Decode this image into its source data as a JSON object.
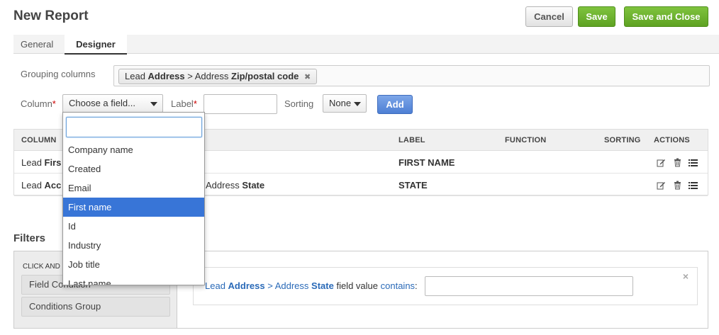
{
  "header": {
    "title": "New Report",
    "cancel_label": "Cancel",
    "save_label": "Save",
    "save_close_label": "Save and Close"
  },
  "tabs": [
    {
      "label": "General",
      "active": false
    },
    {
      "label": "Designer",
      "active": true
    }
  ],
  "designer": {
    "grouping_label": "Grouping columns",
    "grouping_tag": {
      "entity": "Lead",
      "relation": "Address",
      "separator": ">",
      "sub_entity": "Address",
      "field": "Zip/postal code"
    },
    "column_label": "Column",
    "column_placeholder": "Choose a field...",
    "label_label": "Label",
    "label_value": "",
    "sorting_label": "Sorting",
    "sorting_value": "None",
    "add_label": "Add",
    "required_mark": "*"
  },
  "grid": {
    "headers": [
      "COLUMN",
      "LABEL",
      "FUNCTION",
      "SORTING",
      "ACTIONS"
    ],
    "rows": [
      {
        "column_prefix": "Lead",
        "column_bold": "Firs",
        "column_tail": "",
        "column_tail_bold": "",
        "label": "FIRST NAME"
      },
      {
        "column_prefix": "Lead",
        "column_bold": "Acc",
        "column_tail": "Address",
        "column_tail_bold": "State",
        "label": "STATE"
      }
    ],
    "action_icons": [
      "edit-icon",
      "delete-icon",
      "reorder-icon"
    ]
  },
  "dropdown": {
    "search_value": "",
    "options": [
      "Company name",
      "Created",
      "Email",
      "First name",
      "Id",
      "Industry",
      "Job title",
      "Last name"
    ],
    "highlighted": "First name"
  },
  "filters": {
    "title": "Filters",
    "hint": "Click and",
    "items": [
      "Field Condition",
      "Conditions Group"
    ],
    "condition": {
      "entity": "Lead",
      "relation": "Address",
      "separator": ">",
      "sub_entity": "Address",
      "field": "State",
      "text": "field value",
      "operator": "contains",
      "colon": ":",
      "value": ""
    },
    "close_glyph": "×"
  },
  "colors": {
    "accent_blue": "#3875d7",
    "save_green": "#6cb12f",
    "link_blue": "#2a6ab8"
  }
}
